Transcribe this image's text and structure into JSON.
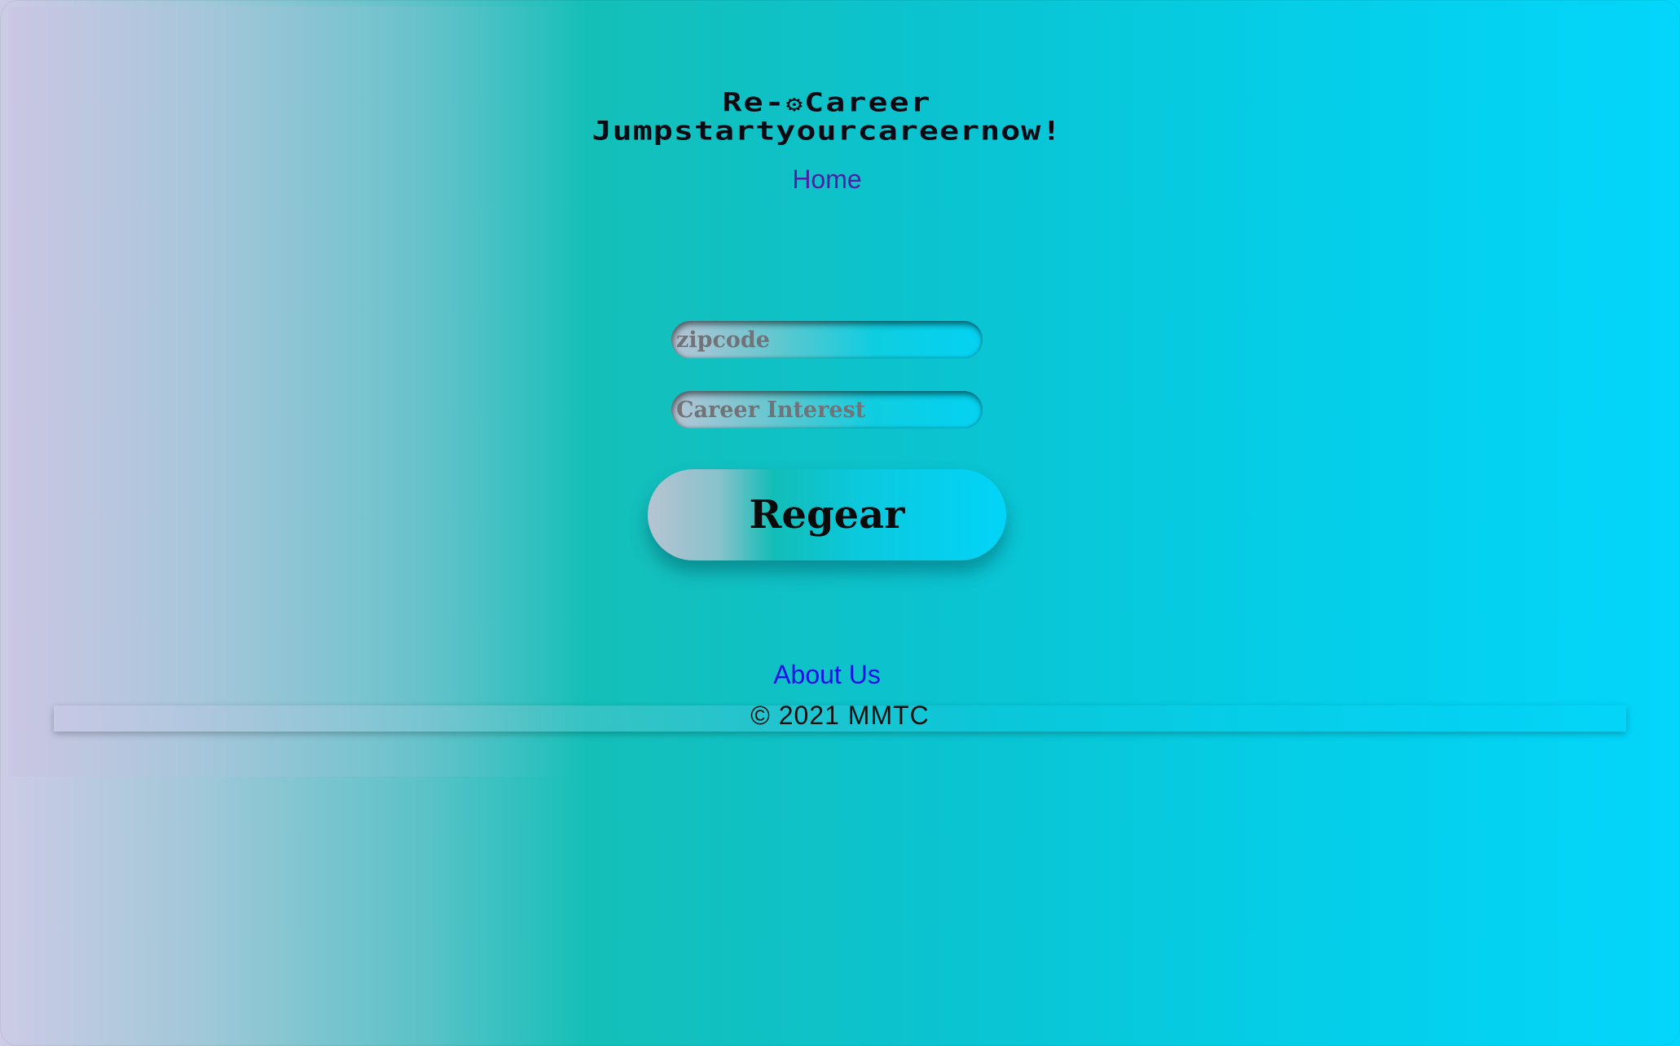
{
  "header": {
    "title_left": "Re-",
    "title_icon": "gear-icon",
    "title_right": "Career",
    "tagline": "Jumpstartyourcareernow!",
    "nav_home": "Home"
  },
  "form": {
    "zipcode_placeholder": "zipcode",
    "career_placeholder": "Career Interest",
    "submit_label": "Regear"
  },
  "footer": {
    "about_link": "About Us",
    "copyright": "© 2021 MMTC"
  },
  "colors": {
    "nav_link": "#4b1fa6",
    "about_link": "#1c10e8",
    "accent_cyan": "#03d6fb",
    "accent_teal": "#14bfb8",
    "accent_lavender": "#cdcbe6"
  }
}
